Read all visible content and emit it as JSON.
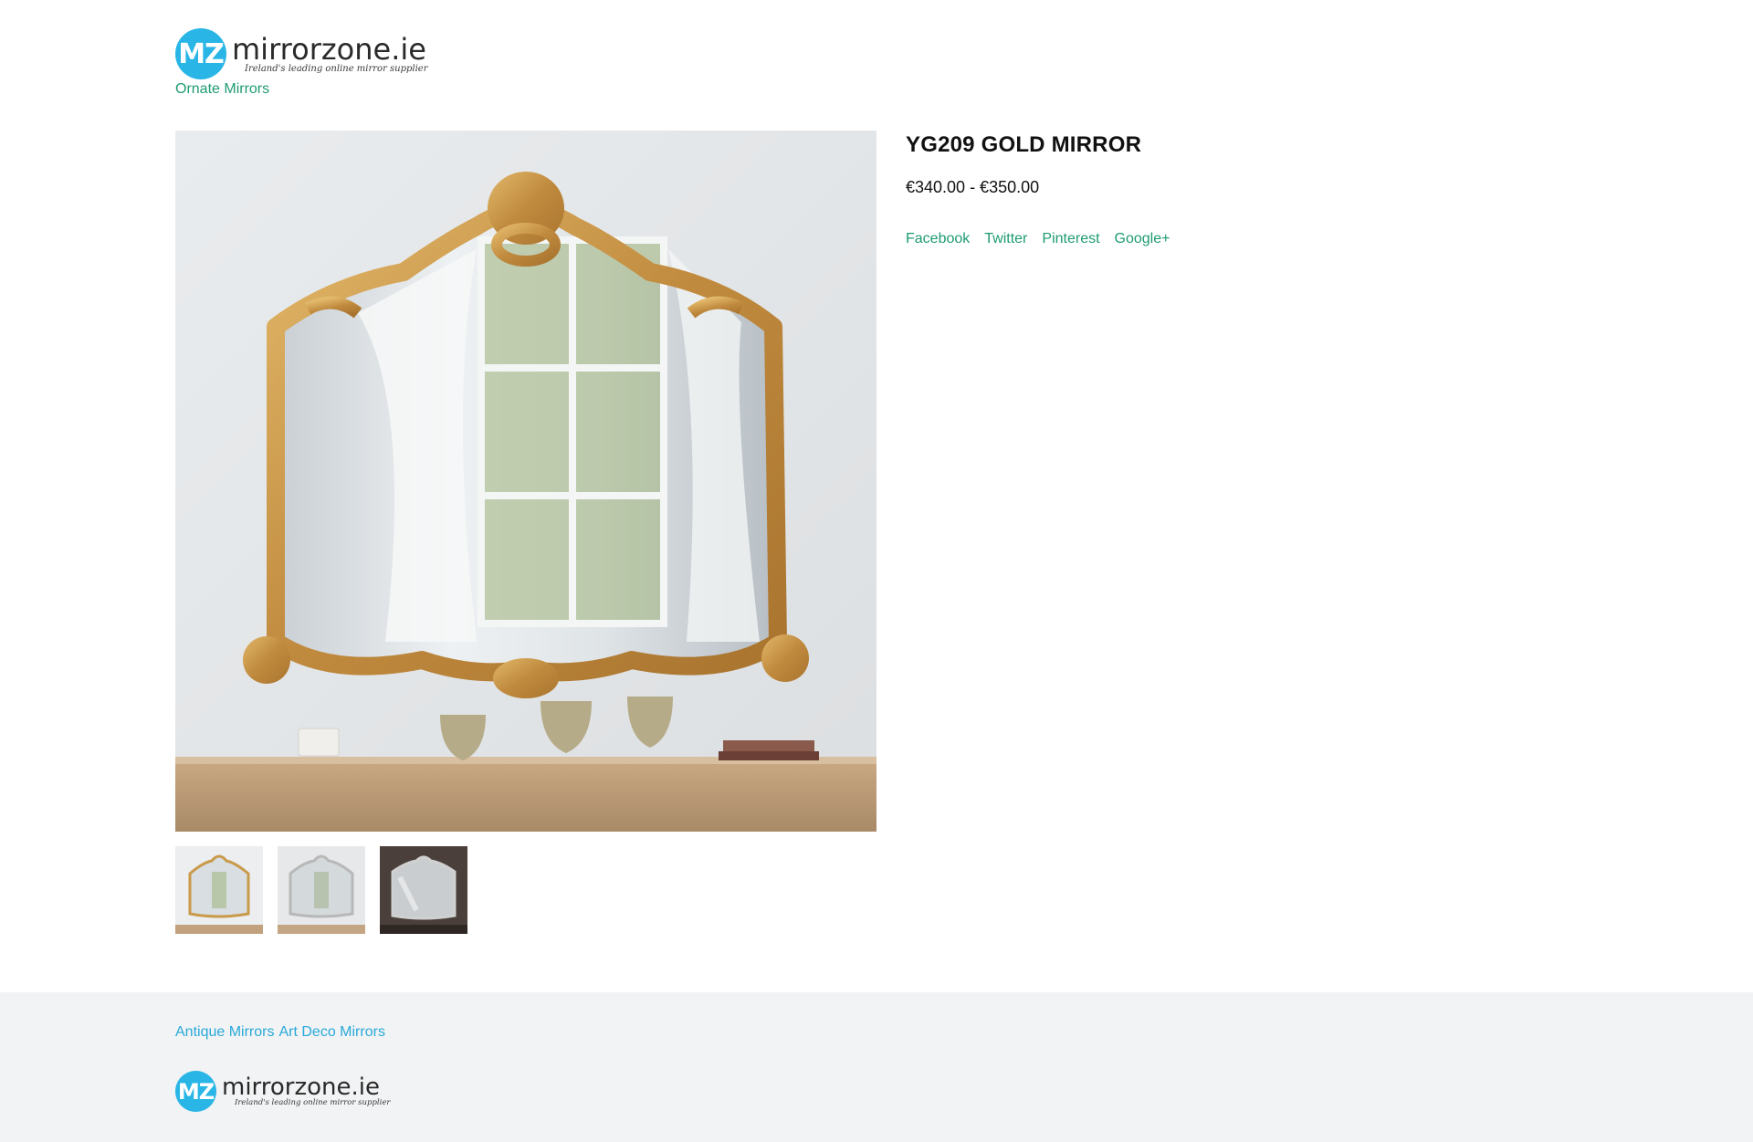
{
  "header": {
    "logo": {
      "badge": "MZ",
      "name": "mirrorzone.ie",
      "tagline": "Ireland's leading online mirror supplier"
    },
    "category_link": "Ornate Mirrors"
  },
  "product": {
    "title": "YG209 GOLD MIRROR",
    "price": "€340.00 - €350.00",
    "share_links": [
      "Facebook",
      "Twitter",
      "Pinterest",
      "Google+"
    ],
    "thumbnails": [
      {
        "variant": "gold",
        "frame_color": "#c99a4a",
        "wall_color": "#eceeef"
      },
      {
        "variant": "silver",
        "frame_color": "#b8b8b8",
        "wall_color": "#e6e8ea"
      },
      {
        "variant": "silver-dark",
        "frame_color": "#d0d0d0",
        "wall_color": "#4a3f3a"
      }
    ]
  },
  "footer": {
    "links": [
      "Antique Mirrors",
      "Art Deco Mirrors"
    ],
    "logo": {
      "badge": "MZ",
      "name": "mirrorzone.ie",
      "tagline": "Ireland's leading online mirror supplier"
    }
  },
  "colors": {
    "accent_link": "#1e9b74",
    "footer_link": "#29a9d9",
    "logo_badge": "#29b6e6",
    "footer_bg": "#f2f3f4"
  }
}
